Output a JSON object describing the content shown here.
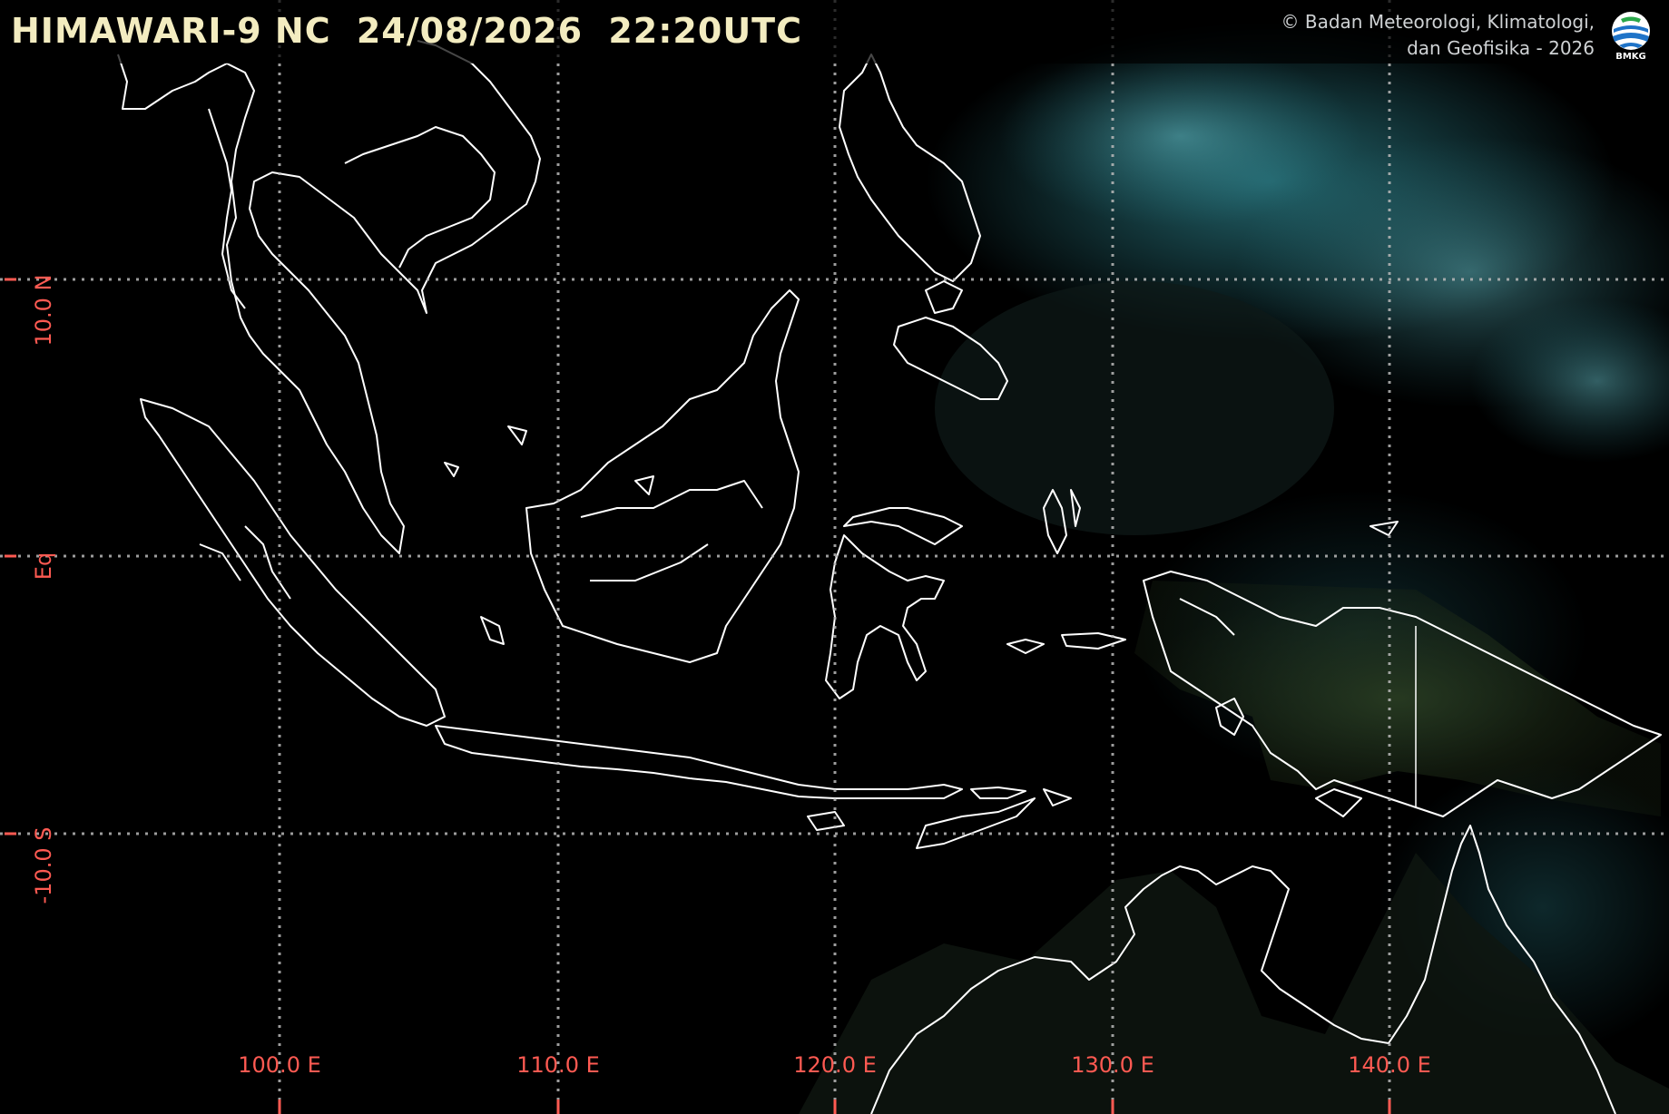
{
  "header": {
    "satellite": "HIMAWARI-9 NC",
    "date": "24/08/2026",
    "time": "22:20UTC",
    "credit_line1": "© Badan Meteorologi, Klimatologi,",
    "credit_line2": "dan Geofisika -  2026",
    "logo_text": "BMKG"
  },
  "longitude_labels": [
    "100.0 E",
    "110.0 E",
    "120.0 E",
    "130.0 E",
    "140.0 E"
  ],
  "latitude_labels": [
    "10.0 N",
    "Eq",
    "-10.0 S"
  ],
  "colors": {
    "grid": "#b8b8b8",
    "label": "#ff5a52",
    "title": "#f3ecc0",
    "coastline": "#ffffff",
    "cloud": "#3fb6c4",
    "land": "#1a2a16"
  },
  "icons": {
    "logo": "bmkg-logo-icon"
  }
}
